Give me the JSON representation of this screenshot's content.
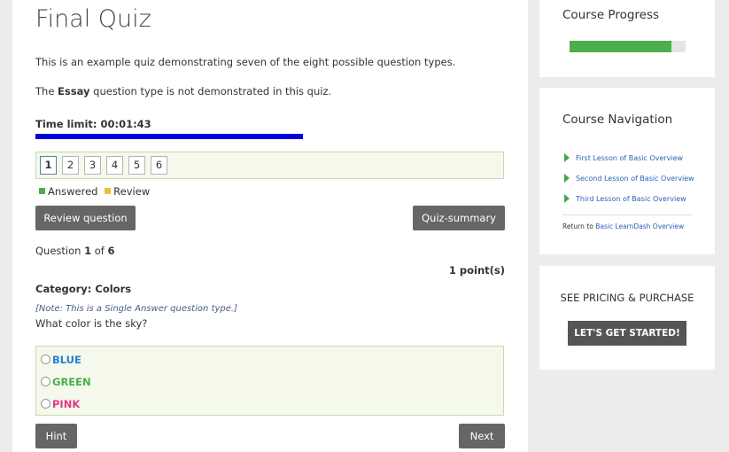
{
  "quiz": {
    "title": "Final Quiz",
    "intro": "This is an example quiz demonstrating seven of the eight possible question types.",
    "essay_note_prefix": "The ",
    "essay_note_bold": "Essay",
    "essay_note_suffix": " question type is not demonstrated in this quiz.",
    "time_limit_label": "Time limit: 00:01:43",
    "time_remaining_fraction": 0.57,
    "question_numbers": [
      "1",
      "2",
      "3",
      "4",
      "5",
      "6"
    ],
    "active_question": "1",
    "legend": {
      "answered_label": "Answered",
      "review_label": "Review",
      "answered_color": "#4cae4c",
      "review_color": "#f0c030"
    },
    "review_button": "Review question",
    "summary_button": "Quiz-summary",
    "question_prefix": "Question ",
    "question_current": "1",
    "question_of": " of ",
    "question_total": "6",
    "points": "1 point(s)",
    "category": "Category: Colors",
    "type_note": "[Note: This is a Single Answer question type.]",
    "question_text": "What color is the sky?",
    "answers": [
      {
        "label": "BLUE",
        "color": "#2a7fd4"
      },
      {
        "label": "GREEN",
        "color": "#4cae4c"
      },
      {
        "label": "PINK",
        "color": "#e0378a"
      }
    ],
    "hint_button": "Hint",
    "next_button": "Next"
  },
  "sidebar": {
    "progress_title": "Course Progress",
    "progress_fraction": 0.88,
    "progress_color": "#4cae4c",
    "navigation_title": "Course Navigation",
    "lessons": [
      "First Lesson of Basic Overview",
      "Second Lesson of Basic Overview",
      "Third Lesson of Basic Overview"
    ],
    "return_prefix": "Return to ",
    "return_link": "Basic LearnDash Overview",
    "pricing_label": "SEE PRICING & PURCHASE",
    "cta_button": "LET'S GET STARTED!"
  }
}
